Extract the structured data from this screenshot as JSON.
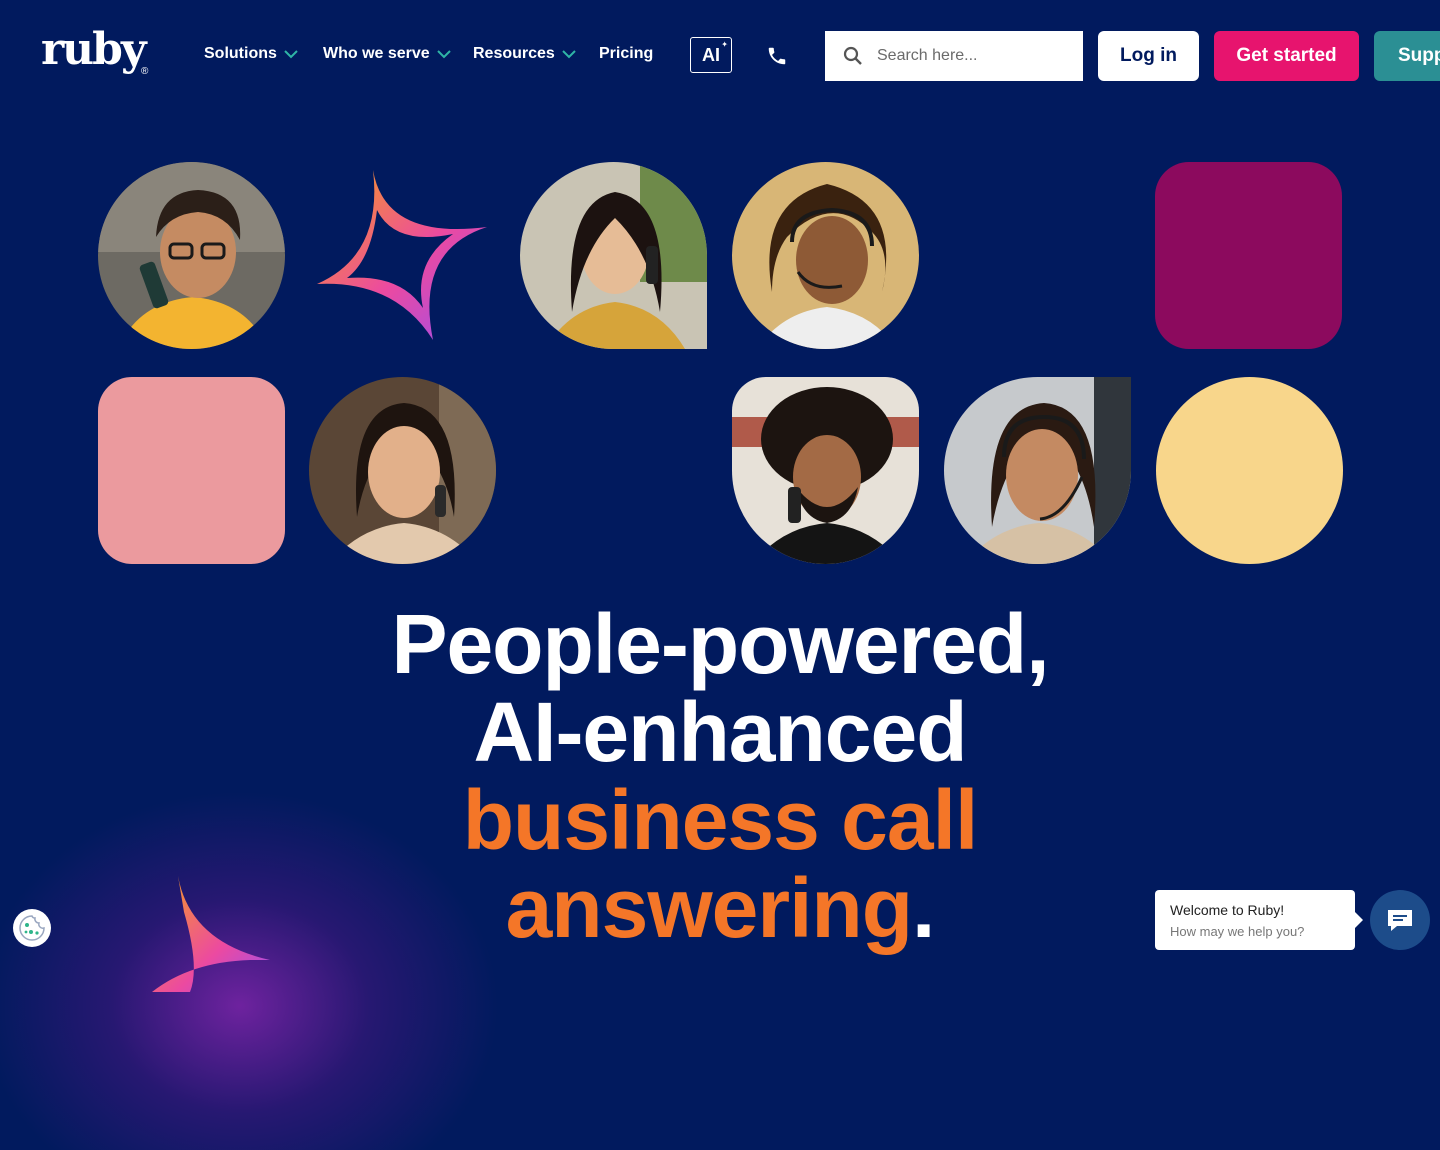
{
  "header": {
    "logo_text": "ruby",
    "logo_mark": "®",
    "nav": [
      {
        "label": "Solutions",
        "has_dropdown": true
      },
      {
        "label": "Who we serve",
        "has_dropdown": true
      },
      {
        "label": "Resources",
        "has_dropdown": true
      },
      {
        "label": "Pricing",
        "has_dropdown": false
      }
    ],
    "ai_label": "AI",
    "phone_icon": "phone-icon",
    "search_placeholder": "Search here...",
    "login_label": "Log in",
    "get_started_label": "Get started",
    "support_label": "Supp"
  },
  "hero": {
    "tiles": [
      {
        "kind": "photo",
        "shape": "circle",
        "desc": "woman-glasses-phone"
      },
      {
        "kind": "star",
        "shape": "none"
      },
      {
        "kind": "photo",
        "shape": "rounded",
        "desc": "woman-phone-smiling"
      },
      {
        "kind": "photo",
        "shape": "circle",
        "desc": "woman-headset"
      },
      {
        "kind": "block",
        "shape": "rounded",
        "color": "#8c0a5e"
      },
      {
        "kind": "block",
        "shape": "rounded",
        "color": "#eb9a9e"
      },
      {
        "kind": "photo",
        "shape": "circle",
        "desc": "woman-phone"
      },
      {
        "kind": "photo",
        "shape": "rounded",
        "desc": "man-curly-hair-phone"
      },
      {
        "kind": "photo",
        "shape": "circle",
        "desc": "woman-headset-smiling"
      },
      {
        "kind": "block",
        "shape": "circle",
        "color": "#f8d68b"
      }
    ]
  },
  "headline": {
    "line1": "People-powered,",
    "line2": "AI-enhanced",
    "line3": "business call",
    "line4": "answering",
    "period": "."
  },
  "chat": {
    "title": "Welcome to Ruby!",
    "subtitle": "How may we help you?"
  },
  "colors": {
    "background": "#011a5e",
    "accent_pink": "#e7146e",
    "accent_teal": "#2b8f94",
    "accent_orange": "#f47628"
  }
}
